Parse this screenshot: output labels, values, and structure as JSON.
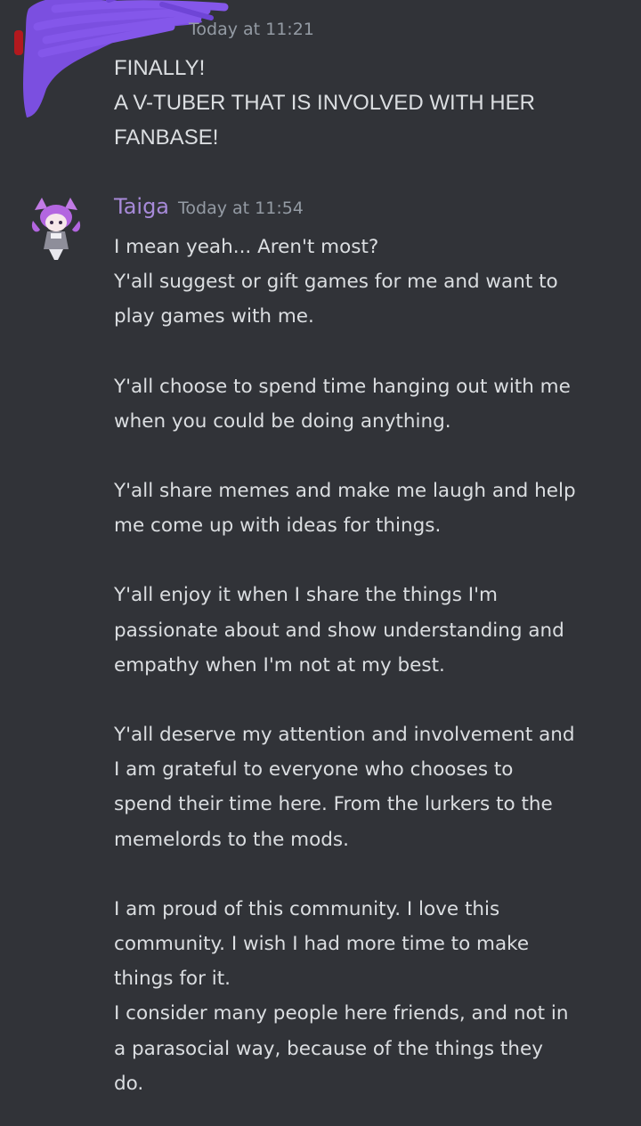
{
  "colors": {
    "background": "#313338",
    "text": "#dbdee1",
    "timestamp": "#949ba4",
    "username": "#a78ad9",
    "redaction": "#7b4fe0"
  },
  "messages": [
    {
      "author": "",
      "timestamp": "Today at 11:21",
      "avatar_icon": "redacted-avatar-scribble",
      "lines": [
        "FINALLY!",
        "A V-TUBER THAT IS INVOLVED WITH HER",
        "FANBASE!"
      ]
    },
    {
      "author": "Taiga",
      "timestamp": "Today at 11:54",
      "avatar_icon": "anime-catgirl-avatar",
      "paragraphs": [
        [
          "I mean yeah... Aren't most?"
        ],
        [
          "Y'all suggest or gift games for me and want to",
          "play games with me."
        ],
        [
          "Y'all choose to spend time hanging out with me",
          "when you could be doing anything."
        ],
        [
          "Y'all share memes and make me laugh and help",
          "me come up with ideas for things."
        ],
        [
          "Y'all enjoy it when I share the things I'm",
          "passionate about and show understanding and",
          "empathy when I'm not at my best."
        ],
        [
          "Y'all deserve my attention and involvement and",
          "I am grateful to everyone who chooses to",
          "spend their time here. From the lurkers to the",
          "memelords to the mods."
        ],
        [
          "I am proud of this community. I love this",
          "community. I wish I had more time to make",
          "things for it."
        ],
        [
          "I consider many people here friends, and not in",
          "a parasocial way, because of the things they",
          "do."
        ]
      ]
    }
  ]
}
